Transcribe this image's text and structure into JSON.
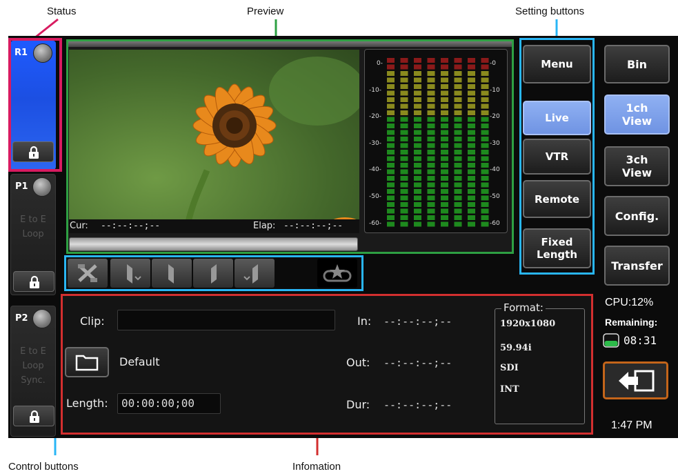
{
  "annotations": {
    "status": "Status",
    "preview": "Preview",
    "setting_buttons": "Setting buttons",
    "control_buttons": "Control buttons",
    "information": "Infomation"
  },
  "slots": [
    {
      "label": "R1",
      "modes": [],
      "color": "#1f5bff"
    },
    {
      "label": "P1",
      "modes": [
        "E to E",
        "Loop"
      ]
    },
    {
      "label": "P2",
      "modes": [
        "E to E",
        "Loop",
        "Sync."
      ]
    }
  ],
  "preview": {
    "cur_label": "Cur:",
    "cur_value": "--:--:--;--",
    "elap_label": "Elap:",
    "elap_value": "--:--:--;--"
  },
  "meter": {
    "left_ticks": [
      "0-",
      "-10-",
      "-20-",
      "-30-",
      "-40-",
      "-50-",
      "-60-"
    ],
    "right_ticks": [
      "-0",
      "-10",
      "-20",
      "-30",
      "-40",
      "-50",
      "-60"
    ],
    "channels": 8
  },
  "setting_buttons": {
    "menu": "Menu",
    "live": "Live",
    "vtr": "VTR",
    "remote": "Remote",
    "fixed_length_1": "Fixed",
    "fixed_length_2": "Length"
  },
  "right_panel": {
    "bin": "Bin",
    "view1_1": "1ch",
    "view1_2": "View",
    "view3_1": "3ch",
    "view3_2": "View",
    "config": "Config.",
    "transfer": "Transfer",
    "cpu": "CPU:12%",
    "remaining_label": "Remaining:",
    "remaining_value": "08:31",
    "clock": "1:47 PM"
  },
  "info": {
    "clip_label": "Clip:",
    "clip_value": "",
    "folder_name": "Default",
    "length_label": "Length:",
    "length_value": "00:00:00;00",
    "in_label": "In:",
    "in_value": "--:--:--;--",
    "out_label": "Out:",
    "out_value": "--:--:--;--",
    "dur_label": "Dur:",
    "dur_value": "--:--:--;--",
    "format_title": "Format:",
    "format_items": [
      "1920x1080",
      "59.94i",
      "SDI",
      "INT"
    ]
  },
  "colors": {
    "status_border": "#d81b60",
    "preview_border": "#2ea043",
    "setting_border": "#29b6f6",
    "info_border": "#d32f2f",
    "active_button": "#7d9fe8",
    "back_button": "#a04a10"
  }
}
